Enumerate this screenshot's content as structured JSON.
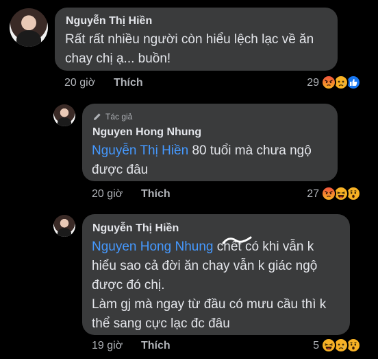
{
  "comments": [
    {
      "author": "Nguyễn Thị Hiền",
      "lines": [
        "Rất rất nhiều người còn hiểu lệch lạc về ăn",
        "chay chị ạ... buồn!"
      ],
      "time": "20 giờ",
      "like_label": "Thích",
      "reaction_count": "29",
      "reactions": [
        "angry",
        "sad",
        "like"
      ]
    },
    {
      "author_badge": "Tác giả",
      "author": "Nguyen Hong Nhung",
      "mention": "Nguyễn Thị Hiền",
      "line1_rest": " 80 tuổi mà chưa ngộ",
      "line2": "được đâu",
      "time": "20 giờ",
      "like_label": "Thích",
      "reaction_count": "27",
      "reactions": [
        "angry",
        "haha",
        "wow"
      ]
    },
    {
      "author": "Nguyễn Thị Hiền",
      "mention": "Nguyen Hong Nhung",
      "line1_rest": " chết có khi vẫn k",
      "lines": [
        "hiểu sao cả đời ăn chay vẫn k giác ngộ",
        "được đó chị.",
        "Làm gj mà ngay từ đầu có mưu cầu thì k",
        "thể sang cực lạc đc đâu"
      ],
      "time": "19 giờ",
      "like_label": "Thích",
      "reaction_count": "5",
      "reactions": [
        "haha",
        "sad",
        "wow"
      ]
    }
  ],
  "colors": {
    "background": "#000000",
    "bubble": "#3a3b3c",
    "text": "#e4e6eb",
    "meta": "#b0b3b8",
    "mention": "#4599ff",
    "like_blue": "#1877f2",
    "angry_top": "#f0533c",
    "yellow": "#f7b125"
  }
}
